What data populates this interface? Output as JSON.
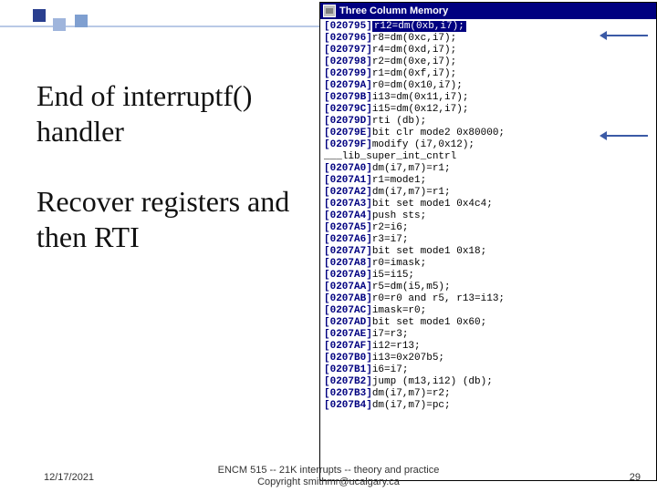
{
  "slide": {
    "heading1": "End of interruptf() handler",
    "heading2": "Recover registers and then RTI"
  },
  "footer": {
    "date": "12/17/2021",
    "line1": "ENCM 515 -- 21K interrupts -- theory and practice",
    "line2": "Copyright smithmr@ucalgary.ca",
    "page": "29"
  },
  "memory_window": {
    "title": "Three Column Memory",
    "rows": [
      {
        "addr": "[020795]",
        "instr": "r12=dm(0xb,i7);",
        "hl": true
      },
      {
        "addr": "[020796]",
        "instr": "r8=dm(0xc,i7);"
      },
      {
        "addr": "[020797]",
        "instr": "r4=dm(0xd,i7);"
      },
      {
        "addr": "[020798]",
        "instr": "r2=dm(0xe,i7);"
      },
      {
        "addr": "[020799]",
        "instr": "r1=dm(0xf,i7);"
      },
      {
        "addr": "[02079A]",
        "instr": "r0=dm(0x10,i7);"
      },
      {
        "addr": "[02079B]",
        "instr": "i13=dm(0x11,i7);"
      },
      {
        "addr": "[02079C]",
        "instr": "i15=dm(0x12,i7);"
      },
      {
        "addr": "[02079D]",
        "instr": "rti (db);"
      },
      {
        "addr": "[02079E]",
        "instr": "bit clr mode2 0x80000;"
      },
      {
        "addr": "[02079F]",
        "instr": "modify (i7,0x12);"
      },
      {
        "addr": "",
        "instr": "___lib_super_int_cntrl"
      },
      {
        "addr": "[0207A0]",
        "instr": "dm(i7,m7)=r1;"
      },
      {
        "addr": "[0207A1]",
        "instr": "r1=mode1;"
      },
      {
        "addr": "[0207A2]",
        "instr": "dm(i7,m7)=r1;"
      },
      {
        "addr": "[0207A3]",
        "instr": "bit set mode1 0x4c4;"
      },
      {
        "addr": "[0207A4]",
        "instr": "push sts;"
      },
      {
        "addr": "[0207A5]",
        "instr": "r2=i6;"
      },
      {
        "addr": "[0207A6]",
        "instr": "r3=i7;"
      },
      {
        "addr": "[0207A7]",
        "instr": "bit set mode1 0x18;"
      },
      {
        "addr": "[0207A8]",
        "instr": "r0=imask;"
      },
      {
        "addr": "[0207A9]",
        "instr": "i5=i15;"
      },
      {
        "addr": "[0207AA]",
        "instr": "r5=dm(i5,m5);"
      },
      {
        "addr": "[0207AB]",
        "instr": "r0=r0 and r5, r13=i13;"
      },
      {
        "addr": "[0207AC]",
        "instr": "imask=r0;"
      },
      {
        "addr": "[0207AD]",
        "instr": "bit set mode1 0x60;"
      },
      {
        "addr": "[0207AE]",
        "instr": "i7=r3;"
      },
      {
        "addr": "[0207AF]",
        "instr": "i12=r13;"
      },
      {
        "addr": "[0207B0]",
        "instr": "i13=0x207b5;"
      },
      {
        "addr": "[0207B1]",
        "instr": "i6=i7;"
      },
      {
        "addr": "[0207B2]",
        "instr": "jump (m13,i12) (db);"
      },
      {
        "addr": "[0207B3]",
        "instr": "dm(i7,m7)=r2;"
      },
      {
        "addr": "[0207B4]",
        "instr": "dm(i7,m7)=pc;"
      }
    ]
  }
}
